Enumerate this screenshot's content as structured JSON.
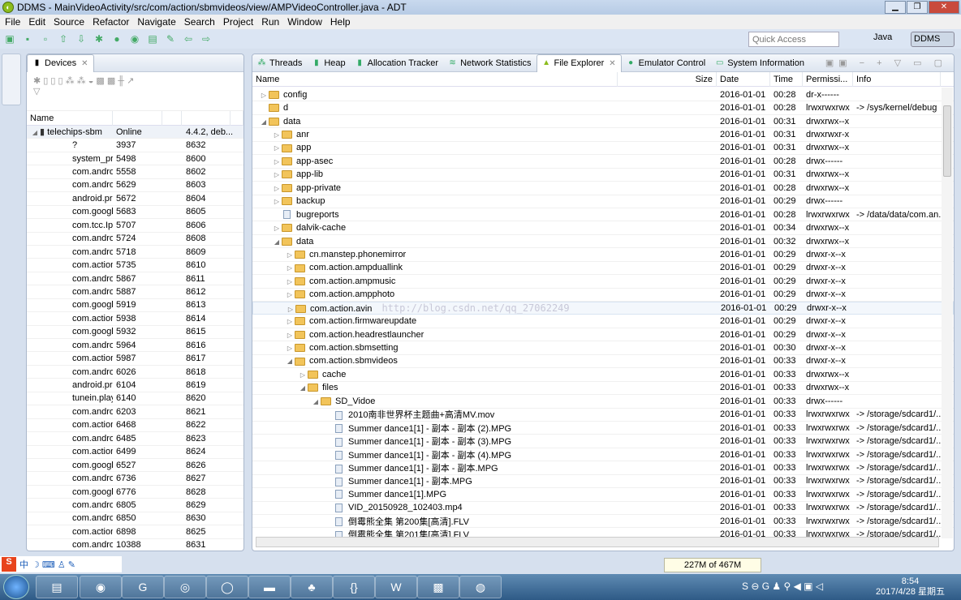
{
  "window": {
    "title": "DDMS - MainVideoActivity/src/com/action/sbmvideos/view/AMPVideoController.java - ADT",
    "min": "▁",
    "max": "❐",
    "close": "✕"
  },
  "menu": [
    "File",
    "Edit",
    "Source",
    "Refactor",
    "Navigate",
    "Search",
    "Project",
    "Run",
    "Window",
    "Help"
  ],
  "toolbar": {
    "quick_access_placeholder": "Quick Access",
    "perspectives": {
      "java": "Java",
      "ddms": "DDMS"
    }
  },
  "devices": {
    "tab": "Devices",
    "columns": [
      "Name",
      "",
      "",
      "",
      ""
    ],
    "device": {
      "name": "telechips-sbm",
      "status": "Online",
      "info": "4.4.2, deb..."
    },
    "processes": [
      [
        "?",
        "3937",
        "8632"
      ],
      [
        "system_prc",
        "5498",
        "8600"
      ],
      [
        "com.andro",
        "5558",
        "8602"
      ],
      [
        "com.andro",
        "5629",
        "8603"
      ],
      [
        "android.pr",
        "5672",
        "8604"
      ],
      [
        "com.googl",
        "5683",
        "8605"
      ],
      [
        "com.tcc.Ipc",
        "5707",
        "8606"
      ],
      [
        "com.andro",
        "5724",
        "8608"
      ],
      [
        "com.andro",
        "5718",
        "8609"
      ],
      [
        "com.action",
        "5735",
        "8610"
      ],
      [
        "com.andro",
        "5867",
        "8611"
      ],
      [
        "com.andro",
        "5887",
        "8612"
      ],
      [
        "com.googl",
        "5919",
        "8613"
      ],
      [
        "com.action",
        "5938",
        "8614"
      ],
      [
        "com.googl",
        "5932",
        "8615"
      ],
      [
        "com.andro",
        "5964",
        "8616"
      ],
      [
        "com.action",
        "5987",
        "8617"
      ],
      [
        "com.andro",
        "6026",
        "8618"
      ],
      [
        "android.pr",
        "6104",
        "8619"
      ],
      [
        "tunein.play",
        "6140",
        "8620"
      ],
      [
        "com.andro",
        "6203",
        "8621"
      ],
      [
        "com.action",
        "6468",
        "8622"
      ],
      [
        "com.andro",
        "6485",
        "8623"
      ],
      [
        "com.action",
        "6499",
        "8624"
      ],
      [
        "com.googl",
        "6527",
        "8626"
      ],
      [
        "com.andro",
        "6736",
        "8627"
      ],
      [
        "com.googl",
        "6776",
        "8628"
      ],
      [
        "com.andro",
        "6805",
        "8629"
      ],
      [
        "com.andro",
        "6850",
        "8630"
      ],
      [
        "com.action",
        "6898",
        "8625"
      ],
      [
        "com.andro",
        "10388",
        "8631"
      ]
    ]
  },
  "file_explorer": {
    "tabs": [
      "Threads",
      "Heap",
      "Allocation Tracker",
      "Network Statistics",
      "File Explorer",
      "Emulator Control",
      "System Information"
    ],
    "active_tab": "File Explorer",
    "columns": [
      "Name",
      "Size",
      "Date",
      "Time",
      "Permissi...",
      "Info"
    ],
    "watermark": "http://blog.csdn.net/qq_27062249",
    "rows": [
      {
        "name": "config",
        "depth": 0,
        "type": "folder",
        "state": "collapsed",
        "date": "2016-01-01",
        "time": "00:28",
        "perm": "dr-x------",
        "info": ""
      },
      {
        "name": "d",
        "depth": 0,
        "type": "folder",
        "state": "none",
        "date": "2016-01-01",
        "time": "00:28",
        "perm": "lrwxrwxrwx",
        "info": "-> /sys/kernel/debug"
      },
      {
        "name": "data",
        "depth": 0,
        "type": "folder",
        "state": "expanded",
        "date": "2016-01-01",
        "time": "00:31",
        "perm": "drwxrwx--x",
        "info": ""
      },
      {
        "name": "anr",
        "depth": 1,
        "type": "folder",
        "state": "collapsed",
        "date": "2016-01-01",
        "time": "00:31",
        "perm": "drwxrwxr-x",
        "info": ""
      },
      {
        "name": "app",
        "depth": 1,
        "type": "folder",
        "state": "collapsed",
        "date": "2016-01-01",
        "time": "00:31",
        "perm": "drwxrwx--x",
        "info": ""
      },
      {
        "name": "app-asec",
        "depth": 1,
        "type": "folder",
        "state": "collapsed",
        "date": "2016-01-01",
        "time": "00:28",
        "perm": "drwx------",
        "info": ""
      },
      {
        "name": "app-lib",
        "depth": 1,
        "type": "folder",
        "state": "collapsed",
        "date": "2016-01-01",
        "time": "00:31",
        "perm": "drwxrwx--x",
        "info": ""
      },
      {
        "name": "app-private",
        "depth": 1,
        "type": "folder",
        "state": "collapsed",
        "date": "2016-01-01",
        "time": "00:28",
        "perm": "drwxrwx--x",
        "info": ""
      },
      {
        "name": "backup",
        "depth": 1,
        "type": "folder",
        "state": "collapsed",
        "date": "2016-01-01",
        "time": "00:29",
        "perm": "drwx------",
        "info": ""
      },
      {
        "name": "bugreports",
        "depth": 1,
        "type": "file",
        "state": "none",
        "date": "2016-01-01",
        "time": "00:28",
        "perm": "lrwxrwxrwx",
        "info": "-> /data/data/com.an..."
      },
      {
        "name": "dalvik-cache",
        "depth": 1,
        "type": "folder",
        "state": "collapsed",
        "date": "2016-01-01",
        "time": "00:34",
        "perm": "drwxrwx--x",
        "info": ""
      },
      {
        "name": "data",
        "depth": 1,
        "type": "folder",
        "state": "expanded",
        "date": "2016-01-01",
        "time": "00:32",
        "perm": "drwxrwx--x",
        "info": ""
      },
      {
        "name": "cn.manstep.phonemirror",
        "depth": 2,
        "type": "folder",
        "state": "collapsed",
        "date": "2016-01-01",
        "time": "00:29",
        "perm": "drwxr-x--x",
        "info": ""
      },
      {
        "name": "com.action.ampduallink",
        "depth": 2,
        "type": "folder",
        "state": "collapsed",
        "date": "2016-01-01",
        "time": "00:29",
        "perm": "drwxr-x--x",
        "info": ""
      },
      {
        "name": "com.action.ampmusic",
        "depth": 2,
        "type": "folder",
        "state": "collapsed",
        "date": "2016-01-01",
        "time": "00:29",
        "perm": "drwxr-x--x",
        "info": ""
      },
      {
        "name": "com.action.ampphoto",
        "depth": 2,
        "type": "folder",
        "state": "collapsed",
        "date": "2016-01-01",
        "time": "00:29",
        "perm": "drwxr-x--x",
        "info": ""
      },
      {
        "name": "com.action.avin",
        "depth": 2,
        "type": "folder",
        "state": "collapsed",
        "date": "2016-01-01",
        "time": "00:29",
        "perm": "drwxr-x--x",
        "info": "",
        "hover": true
      },
      {
        "name": "com.action.firmwareupdate",
        "depth": 2,
        "type": "folder",
        "state": "collapsed",
        "date": "2016-01-01",
        "time": "00:29",
        "perm": "drwxr-x--x",
        "info": ""
      },
      {
        "name": "com.action.headrestlauncher",
        "depth": 2,
        "type": "folder",
        "state": "collapsed",
        "date": "2016-01-01",
        "time": "00:29",
        "perm": "drwxr-x--x",
        "info": ""
      },
      {
        "name": "com.action.sbmsetting",
        "depth": 2,
        "type": "folder",
        "state": "collapsed",
        "date": "2016-01-01",
        "time": "00:30",
        "perm": "drwxr-x--x",
        "info": ""
      },
      {
        "name": "com.action.sbmvideos",
        "depth": 2,
        "type": "folder",
        "state": "expanded",
        "date": "2016-01-01",
        "time": "00:33",
        "perm": "drwxr-x--x",
        "info": ""
      },
      {
        "name": "cache",
        "depth": 3,
        "type": "folder",
        "state": "collapsed",
        "date": "2016-01-01",
        "time": "00:33",
        "perm": "drwxrwx--x",
        "info": ""
      },
      {
        "name": "files",
        "depth": 3,
        "type": "folder",
        "state": "expanded",
        "date": "2016-01-01",
        "time": "00:33",
        "perm": "drwxrwx--x",
        "info": ""
      },
      {
        "name": "SD_Vidoe",
        "depth": 4,
        "type": "folder",
        "state": "expanded",
        "date": "2016-01-01",
        "time": "00:33",
        "perm": "drwx------",
        "info": ""
      },
      {
        "name": "2010南非世界杯主题曲+高清MV.mov",
        "depth": 5,
        "type": "file",
        "state": "none",
        "date": "2016-01-01",
        "time": "00:33",
        "perm": "lrwxrwxrwx",
        "info": "-> /storage/sdcard1/..."
      },
      {
        "name": "Summer dance1[1] - 副本 - 副本 (2).MPG",
        "depth": 5,
        "type": "file",
        "state": "none",
        "date": "2016-01-01",
        "time": "00:33",
        "perm": "lrwxrwxrwx",
        "info": "-> /storage/sdcard1/..."
      },
      {
        "name": "Summer dance1[1] - 副本 - 副本 (3).MPG",
        "depth": 5,
        "type": "file",
        "state": "none",
        "date": "2016-01-01",
        "time": "00:33",
        "perm": "lrwxrwxrwx",
        "info": "-> /storage/sdcard1/..."
      },
      {
        "name": "Summer dance1[1] - 副本 - 副本 (4).MPG",
        "depth": 5,
        "type": "file",
        "state": "none",
        "date": "2016-01-01",
        "time": "00:33",
        "perm": "lrwxrwxrwx",
        "info": "-> /storage/sdcard1/..."
      },
      {
        "name": "Summer dance1[1] - 副本 - 副本.MPG",
        "depth": 5,
        "type": "file",
        "state": "none",
        "date": "2016-01-01",
        "time": "00:33",
        "perm": "lrwxrwxrwx",
        "info": "-> /storage/sdcard1/..."
      },
      {
        "name": "Summer dance1[1] - 副本.MPG",
        "depth": 5,
        "type": "file",
        "state": "none",
        "date": "2016-01-01",
        "time": "00:33",
        "perm": "lrwxrwxrwx",
        "info": "-> /storage/sdcard1/..."
      },
      {
        "name": "Summer dance1[1].MPG",
        "depth": 5,
        "type": "file",
        "state": "none",
        "date": "2016-01-01",
        "time": "00:33",
        "perm": "lrwxrwxrwx",
        "info": "-> /storage/sdcard1/..."
      },
      {
        "name": "VID_20150928_102403.mp4",
        "depth": 5,
        "type": "file",
        "state": "none",
        "date": "2016-01-01",
        "time": "00:33",
        "perm": "lrwxrwxrwx",
        "info": "-> /storage/sdcard1/..."
      },
      {
        "name": "倒霉熊全集 第200集[高清].FLV",
        "depth": 5,
        "type": "file",
        "state": "none",
        "date": "2016-01-01",
        "time": "00:33",
        "perm": "lrwxrwxrwx",
        "info": "-> /storage/sdcard1/..."
      },
      {
        "name": "倒霉熊全集 第201集[高清].FLV",
        "depth": 5,
        "type": "file",
        "state": "none",
        "date": "2016-01-01",
        "time": "00:33",
        "perm": "lrwxrwxrwx",
        "info": "-> /storage/sdcard1/..."
      }
    ]
  },
  "status": {
    "heap": "227M of 467M",
    "ime": "中"
  },
  "taskbar": {
    "time": "8:54",
    "date": "2017/4/28 星期五"
  }
}
